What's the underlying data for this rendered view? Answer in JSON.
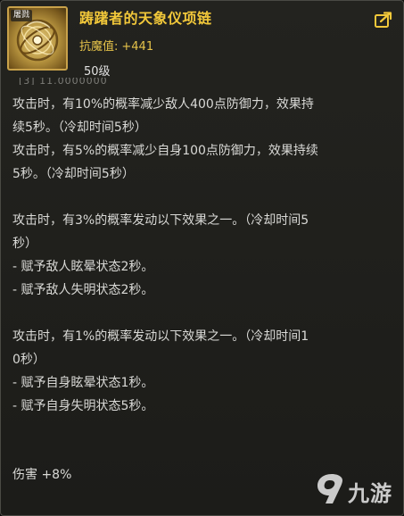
{
  "item": {
    "icon_tag": "屠戮",
    "icon": "gold-medallion-icon",
    "name": "踌躇者的天象仪项链",
    "stat_label": "抗魔值:",
    "stat_value": "+441",
    "level": "50级"
  },
  "description": {
    "cut_line": "[3] 11.0000000",
    "lines": [
      "攻击时，有10%的概率减少敌人400点防御力，效果持",
      "续5秒。（冷却时间5秒）",
      "攻击时，有5%的概率减少自身100点防御力，效果持续",
      "5秒。（冷却时间5秒）",
      "",
      "攻击时，有3%的概率发动以下效果之一。（冷却时间5",
      "秒）",
      "- 赋予敌人眩晕状态2秒。",
      "- 赋予敌人失明状态2秒。",
      "",
      "攻击时，有1%的概率发动以下效果之一。（冷却时间1",
      "0秒）",
      "- 赋予自身眩晕状态1秒。",
      "- 赋予自身失明状态5秒。"
    ],
    "damage": "伤害 +8%"
  },
  "watermark": {
    "text": "九游",
    "icon": "nine-game-logo-icon"
  },
  "colors": {
    "name": "#f2c83a",
    "stat": "#e6c34a",
    "body_text": "#d9d9d6",
    "background": "#1f1f1c"
  }
}
